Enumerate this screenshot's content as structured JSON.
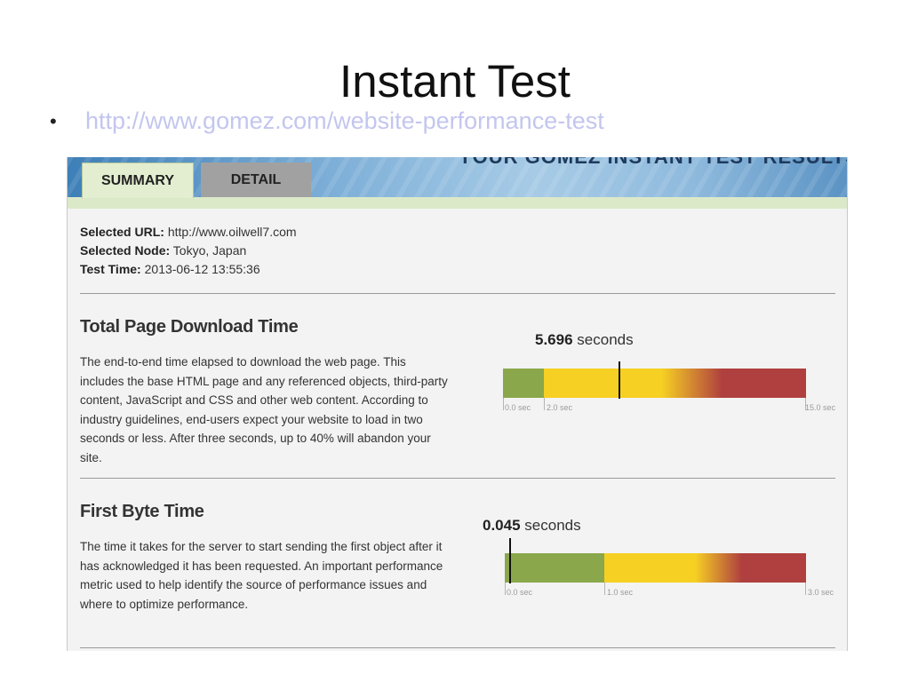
{
  "slide": {
    "title": "Instant Test",
    "bullet": "•",
    "link": "http://www.gomez.com/website-performance-test"
  },
  "banner": {
    "title": "YOUR GOMEZ INSTANT TEST RESULTS"
  },
  "tabs": [
    {
      "label": "SUMMARY",
      "active": true
    },
    {
      "label": "DETAIL",
      "active": false
    }
  ],
  "meta": {
    "url_label": "Selected URL:",
    "url_value": "http://www.oilwell7.com",
    "node_label": "Selected Node:",
    "node_value": "Tokyo, Japan",
    "time_label": "Test Time:",
    "time_value": "2013-06-12 13:55:36"
  },
  "sections": {
    "download": {
      "title": "Total Page Download Time",
      "desc": "The end-to-end time elapsed to download the web page. This includes the base HTML page and any referenced objects, third-party content, JavaScript and CSS and other web content. According to industry guidelines, end-users expect your website to load in two seconds or less. After three seconds, up to 40% will abandon your site.",
      "value": "5.696",
      "unit": "seconds",
      "value_num": 5.696,
      "tick_labels": [
        "0.0 sec",
        "2.0 sec",
        "15.0 sec"
      ],
      "tick_values": [
        0,
        2,
        15
      ]
    },
    "first_byte": {
      "title": "First Byte Time",
      "desc": "The time it takes for the server to start sending the first object after it has acknowledged it has been requested. An important performance metric used to help identify the source of performance issues and where to optimize performance.",
      "value": "0.045",
      "unit": "seconds",
      "value_num": 0.045,
      "tick_labels": [
        "0.0 sec",
        "1.0 sec",
        "3.0 sec"
      ],
      "tick_values": [
        0,
        1,
        3
      ]
    }
  },
  "colors": {
    "good": "#8aa74b",
    "ok": "#f6d023",
    "bad": "#b0403f",
    "link": "#c3c6ee"
  }
}
